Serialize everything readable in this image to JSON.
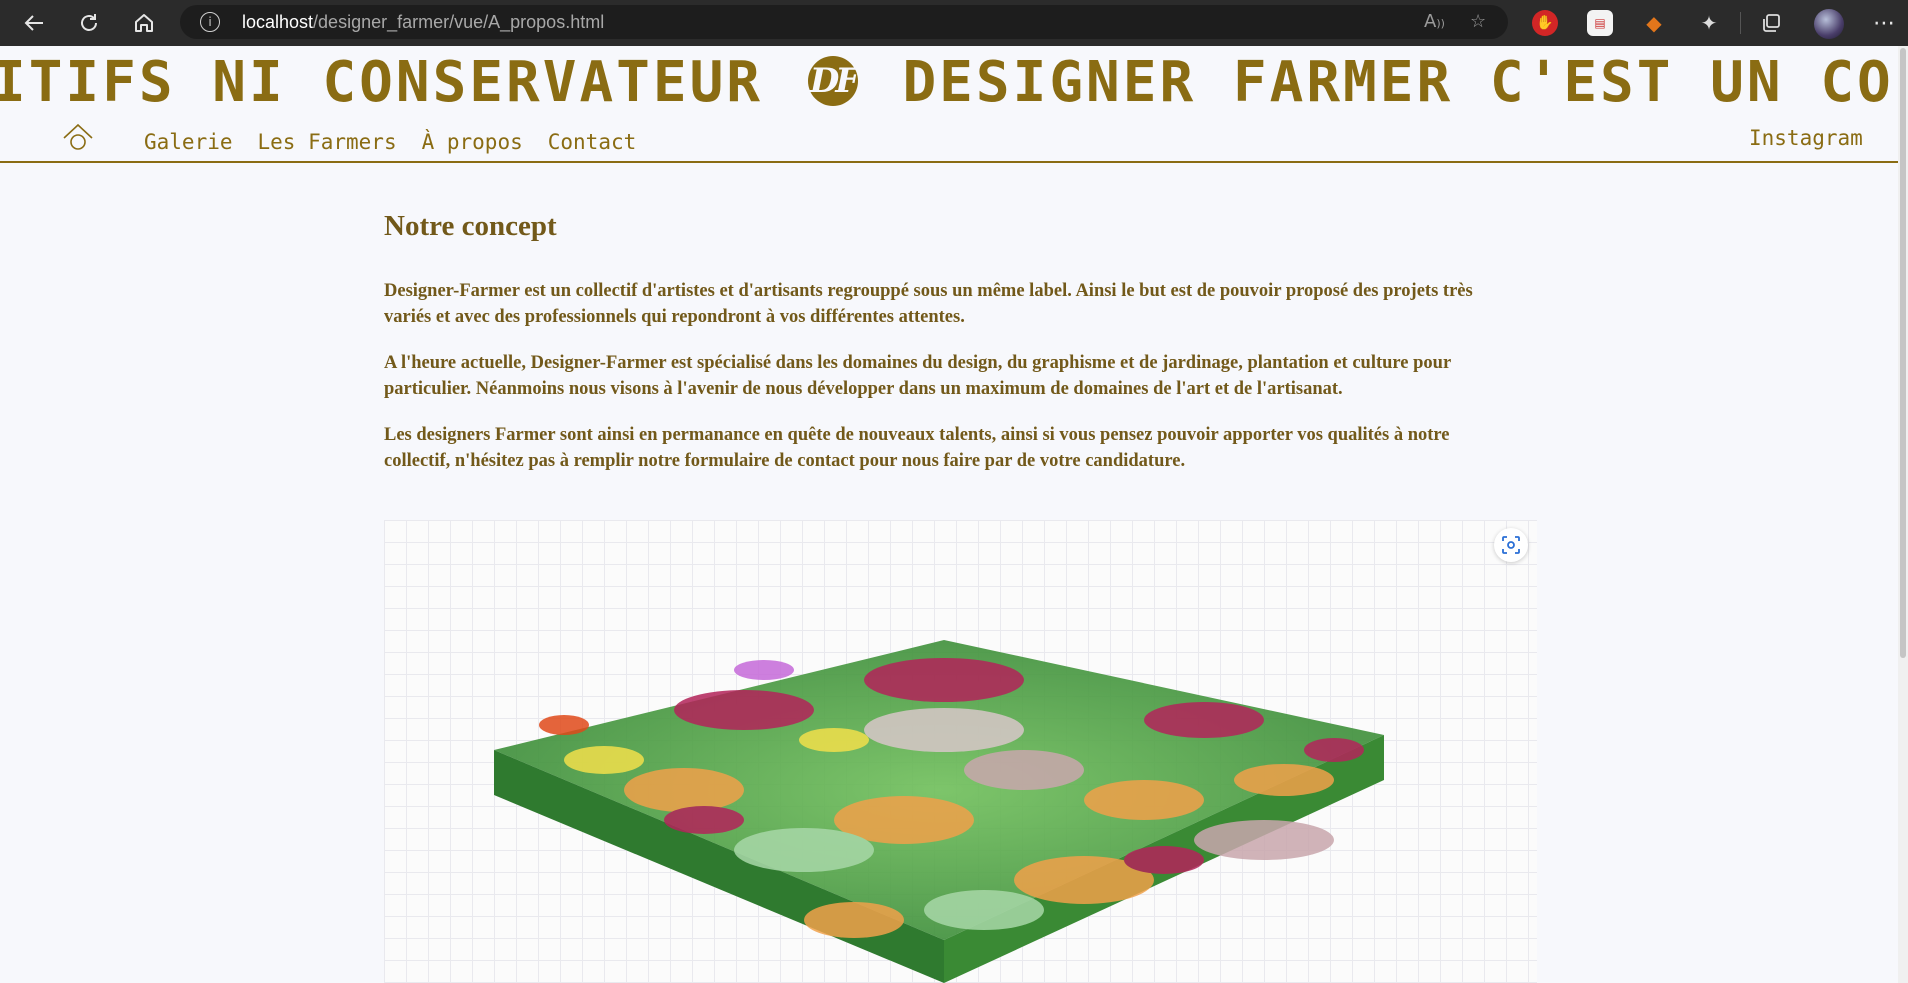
{
  "browser": {
    "url_host": "localhost",
    "url_path": "/designer_farmer/vue/A_propos.html",
    "icons": [
      "back-icon",
      "refresh-icon",
      "home-icon",
      "info-icon",
      "read-aloud-icon",
      "favorite-icon",
      "ublock-icon",
      "extension-icon",
      "metamask-icon",
      "extensions-icon",
      "collections-icon",
      "profile-avatar",
      "more-icon"
    ]
  },
  "marquee": {
    "before": "iTiFS Ni CONSERVATEUR",
    "logo": "df",
    "after": "DESIGNER FARMER C'EST UN COLLECTIF D'ARTISTES ET DE"
  },
  "nav": {
    "links": [
      "Galerie",
      "Les Farmers",
      "À propos",
      "Contact"
    ],
    "instagram": "Instagram"
  },
  "content": {
    "title": "Notre concept",
    "paragraphs": [
      "Designer-Farmer est un collectif d'artistes et d'artisants regrouppé sous un même label. Ainsi le but est de pouvoir proposé des projets très variés et avec des professionnels qui repondront à vos différentes attentes.",
      "A l'heure actuelle, Designer-Farmer est spécialisé dans les domaines du design, du graphisme et de jardinage, plantation et culture pour particulier. Néanmoins nous visons à l'avenir de nous développer dans un maximum de domaines de l'art et de l'artisanat.",
      "Les designers Farmer sont ainsi en permanance en quête de nouveaux talents, ainsi si vous pensez pouvoir apporter vos qualités à notre collectif, n'hésitez pas à remplir notre formulaire de contact pour nous faire par de votre candidature."
    ]
  },
  "colors": {
    "accent": "#8a6c13",
    "text": "#72591a",
    "background": "#f7f8fc"
  }
}
